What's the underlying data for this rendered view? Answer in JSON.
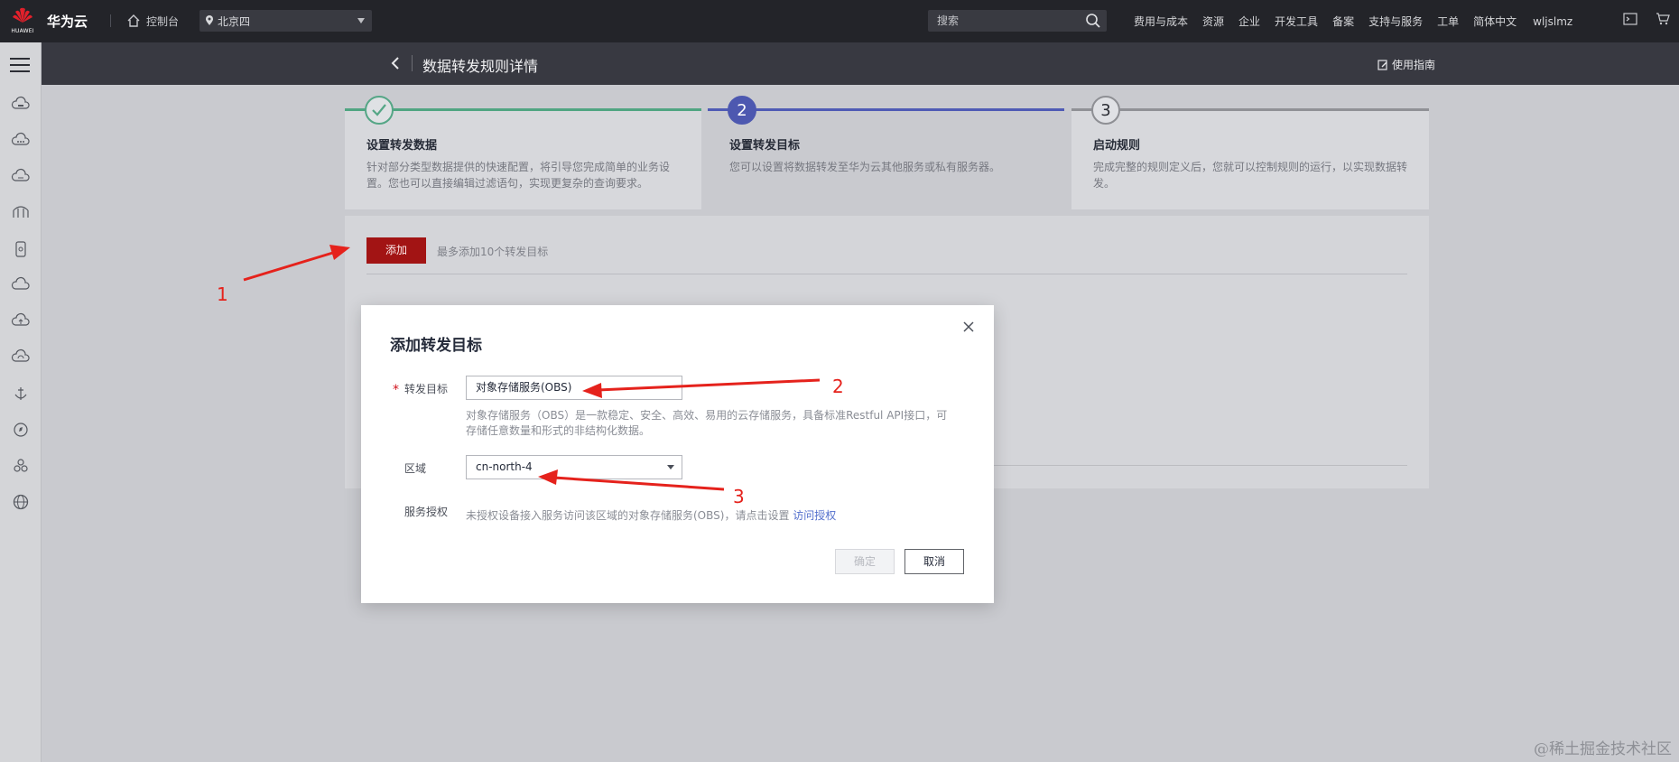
{
  "topbar": {
    "logo_text": "HUAWEI",
    "brand": "华为云",
    "console_label": "控制台",
    "region_label": "北京四",
    "search_placeholder": "搜索",
    "nav_items": [
      "费用与成本",
      "资源",
      "企业",
      "开发工具",
      "备案",
      "支持与服务",
      "工单",
      "简体中文"
    ],
    "username": "wljslmz"
  },
  "page": {
    "title": "数据转发规则详情",
    "guide_label": "使用指南"
  },
  "steps": [
    {
      "number": "",
      "title": "设置转发数据",
      "desc": "针对部分类型数据提供的快速配置，将引导您完成简单的业务设置。您也可以直接编辑过滤语句，实现更复杂的查询要求。",
      "status": "done"
    },
    {
      "number": "2",
      "title": "设置转发目标",
      "desc": "您可以设置将数据转发至华为云其他服务或私有服务器。",
      "status": "active"
    },
    {
      "number": "3",
      "title": "启动规则",
      "desc": "完成完整的规则定义后，您就可以控制规则的运行，以实现数据转发。",
      "status": "pending"
    }
  ],
  "panel": {
    "add_button": "添加",
    "add_tip": "最多添加10个转发目标"
  },
  "modal": {
    "title": "添加转发目标",
    "target_label": "转发目标",
    "target_value": "对象存储服务(OBS)",
    "target_help": "对象存储服务（OBS）是一款稳定、安全、高效、易用的云存储服务，具备标准Restful API接口，可存储任意数量和形式的非结构化数据。",
    "region_label": "区域",
    "region_value": "cn-north-4",
    "auth_label": "服务授权",
    "auth_text": "未授权设备接入服务访问该区域的对象存储服务(OBS)，请点击设置",
    "auth_link": "访问授权",
    "ok_button": "确定",
    "cancel_button": "取消"
  },
  "annotations": [
    "1",
    "2",
    "3"
  ],
  "watermark": "@稀土掘金技术社区",
  "colors": {
    "topbar": "#232429",
    "primary_red": "#a21414",
    "step_done": "#50a582",
    "step_active": "#4f5bb5",
    "arrow": "#e5221c",
    "link": "#526ecc"
  }
}
